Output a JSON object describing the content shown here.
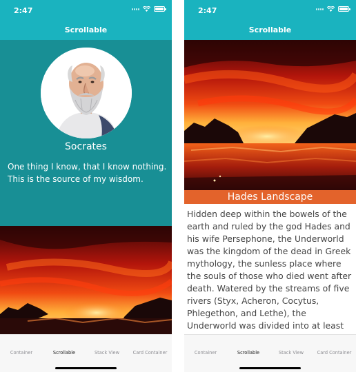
{
  "status_bar": {
    "time": "2:47"
  },
  "nav": {
    "title": "Scrollable"
  },
  "profile": {
    "name": "Socrates",
    "quote": "One thing I know, that I know nothing. This is the source of my wisdom."
  },
  "landscape": {
    "caption": "Hades Landscape",
    "text": "Hidden deep within the bowels of the earth and ruled by the god Hades and his wife Persephone, the Underworld was the kingdom of the dead in Greek mythology, the sunless place where the souls of those who died went after death. Watered by the streams of five rivers (Styx, Acheron, Cocytus, Phlegethon, and Lethe), the Underworld was divided into at least four regions:"
  },
  "tabs": [
    {
      "label": "Container"
    },
    {
      "label": "Scrollable",
      "active": true
    },
    {
      "label": "Stack View"
    },
    {
      "label": "Card Container"
    }
  ],
  "colors": {
    "header": "#1ab3bf",
    "profile_background": "#188f95",
    "caption_background": "#e3632b"
  }
}
